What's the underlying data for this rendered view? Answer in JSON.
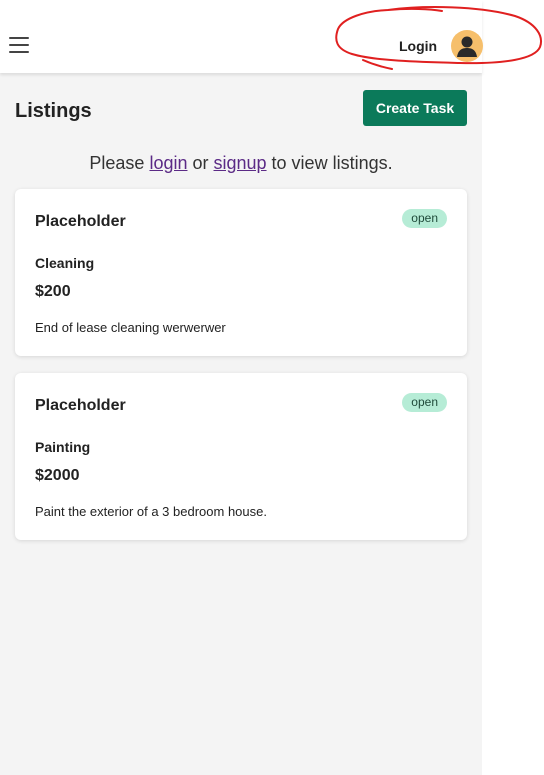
{
  "header": {
    "login_label": "Login",
    "menu_icon": "hamburger-menu-icon",
    "avatar_icon": "user-avatar-icon"
  },
  "main": {
    "title": "Listings",
    "create_button_label": "Create Task",
    "prompt": {
      "before": "Please ",
      "login": "login",
      "middle": " or ",
      "signup": "signup",
      "after": " to view listings."
    }
  },
  "listings": [
    {
      "title": "Placeholder",
      "status": "open",
      "category": "Cleaning",
      "price": "$200",
      "description": "End of lease cleaning werwerwer"
    },
    {
      "title": "Placeholder",
      "status": "open",
      "category": "Painting",
      "price": "$2000",
      "description": "Paint the exterior of a 3 bedroom house."
    }
  ],
  "colors": {
    "accent": "#0b7a5a",
    "badge_bg": "#b6ecd6",
    "avatar_bg": "#f6bf6b",
    "page_bg": "#f4f4f4",
    "annotation": "#e02020"
  }
}
